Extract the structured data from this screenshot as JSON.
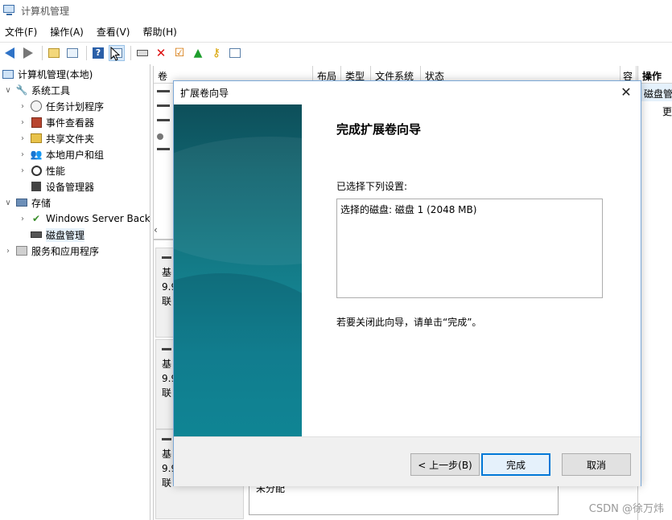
{
  "window": {
    "title": "计算机管理"
  },
  "menu": [
    "文件(F)",
    "操作(A)",
    "查看(V)",
    "帮助(H)"
  ],
  "toolbar": {
    "icons": [
      "back-icon",
      "forward-icon",
      "up-folder-icon",
      "show-tree-icon",
      "help-icon",
      "properties-icon",
      "connect-icon",
      "delete-icon",
      "check-icon",
      "import-icon",
      "search-icon",
      "list-icon"
    ]
  },
  "tree": {
    "root": "计算机管理(本地)",
    "system_tools": "系统工具",
    "task_scheduler": "任务计划程序",
    "event_viewer": "事件查看器",
    "shared_folders": "共享文件夹",
    "local_users": "本地用户和组",
    "performance": "性能",
    "device_manager": "设备管理器",
    "storage": "存储",
    "windows_backup": "Windows Server Back",
    "disk_management": "磁盘管理",
    "services_apps": "服务和应用程序"
  },
  "volume_columns": [
    "卷",
    "布局",
    "类型",
    "文件系统",
    "状态",
    "容"
  ],
  "disk_blocks": [
    {
      "line1": "基",
      "line2": "9.9",
      "line3": "联"
    },
    {
      "line1": "基",
      "line2": "9.9",
      "line3": "联"
    },
    {
      "line1": "基",
      "line2": "9.9",
      "line3": "联"
    }
  ],
  "unallocated_label": "未分配",
  "actions": {
    "header": "操作",
    "item": "磁盘管理",
    "more": "更"
  },
  "dialog": {
    "title": "扩展卷向导",
    "heading": "完成扩展卷向导",
    "subheading": "已选择下列设置:",
    "summary": "选择的磁盘: 磁盘 1 (2048 MB)",
    "note": "若要关闭此向导，请单击“完成”。",
    "buttons": {
      "back": "< 上一步(B)",
      "finish": "完成",
      "cancel": "取消"
    }
  },
  "watermark": "CSDN @徐万炜"
}
